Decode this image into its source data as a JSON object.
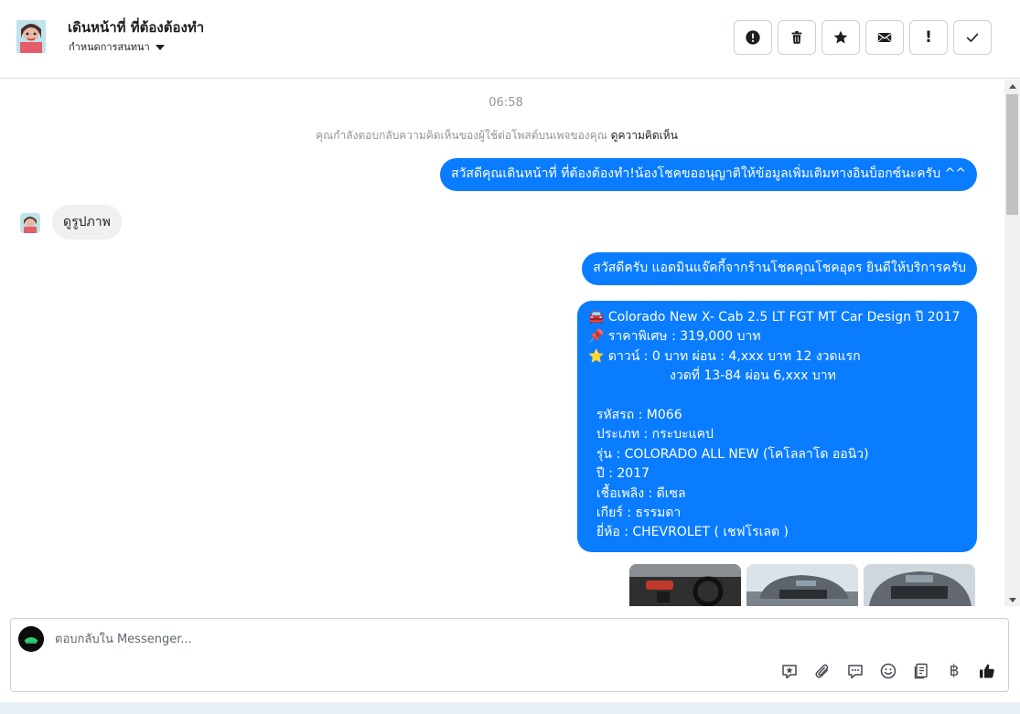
{
  "header": {
    "title": "เดินหน้าที่ ที่ต้องต้องทำ",
    "subtitle": "กำหนดการสนทนา",
    "actions": [
      {
        "name": "spam-button",
        "icon": "alert-circle-icon"
      },
      {
        "name": "delete-button",
        "icon": "trash-icon"
      },
      {
        "name": "star-button",
        "icon": "star-icon"
      },
      {
        "name": "mark-unread-button",
        "icon": "envelope-icon"
      },
      {
        "name": "important-button",
        "icon": "exclamation-icon",
        "glyph": "!"
      },
      {
        "name": "done-button",
        "icon": "checkmark-icon"
      }
    ]
  },
  "conversation": {
    "timestamp": "06:58",
    "notice_text": "คุณกำลังตอบกลับความคิดเห็นของผู้ใช้ต่อโพสต์บนเพจของคุณ",
    "notice_link": "ดูความคิดเห็น",
    "messages": [
      {
        "direction": "out",
        "text": "สวัสดีคุณเดินหน้าที่ ที่ต้องต้องทำ!น้องโชคขออนุญาติให้ข้อมูลเพิ่มเติมทางอินบ็อกซ์นะครับ ^^"
      },
      {
        "direction": "in",
        "text": "ดูรูปภาพ"
      },
      {
        "direction": "out",
        "text": "สวัสดีครับ แอดมินแจ๊คกี้จากร้านโชคคุณโชคอุดร ยินดีให้บริการครับ"
      },
      {
        "direction": "out",
        "text": "🚘 Colorado New X- Cab 2.5 LT FGT MT Car Design ปี 2017\n📌 ราคาพิเศษ : 319,000 บาท\n⭐ ดาวน์ : 0 บาท ผ่อน : 4,xxx บาท 12 งวดแรก\n                    งวดที่ 13-84 ผ่อน 6,xxx บาท\n\n  รหัสรถ : M066\n  ประเภท : กระบะแคป\n  รุ่น : COLORADO ALL NEW (โคโลลาโด ออนิว)\n  ปี : 2017\n  เชื้อเพลิง : ดีเซล\n  เกียร์ : ธรรมดา\n  ยี่ห้อ : CHEVROLET ( เชฟโรเลต )"
      }
    ],
    "images": [
      "car-interior-photo",
      "car-front-photo",
      "car-front-closeup-photo"
    ]
  },
  "composer": {
    "placeholder": "ตอบกลับใน Messenger...",
    "tools": [
      {
        "name": "saved-reply-button",
        "icon": "star-bubble-icon"
      },
      {
        "name": "attach-button",
        "icon": "paperclip-icon"
      },
      {
        "name": "quick-reply-button",
        "icon": "speech-bubble-icon"
      },
      {
        "name": "emoji-button",
        "icon": "smile-icon"
      },
      {
        "name": "catalog-button",
        "icon": "document-icon"
      },
      {
        "name": "payment-button",
        "icon": "baht-icon",
        "glyph": "฿"
      },
      {
        "name": "like-button",
        "icon": "thumbs-up-icon"
      }
    ]
  },
  "colors": {
    "outgoing_bubble": "#0a7cff",
    "incoming_bubble": "#f0f0f0",
    "muted_text": "#90949c",
    "border": "#ccd0d5"
  }
}
